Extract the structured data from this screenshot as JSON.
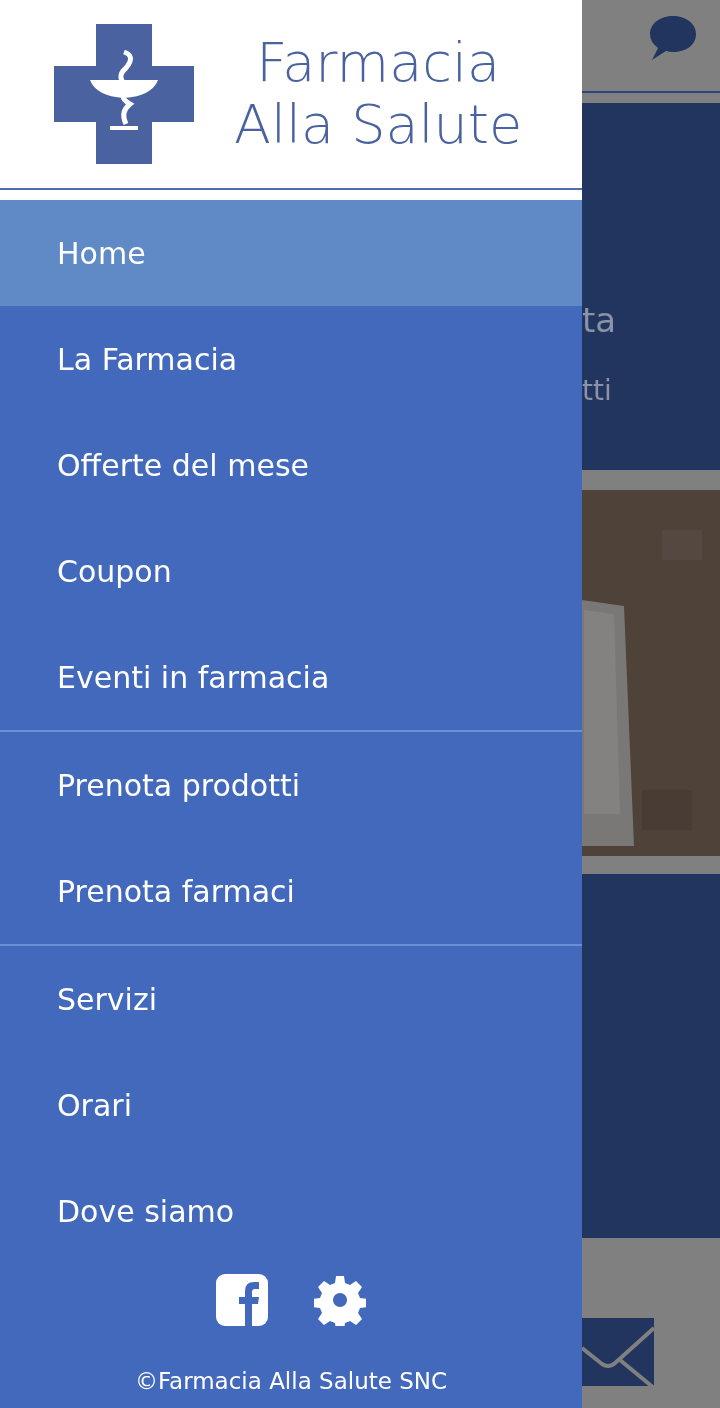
{
  "drawer": {
    "logo": {
      "line_1": "Farmacia",
      "line_2": "Alla Salute"
    },
    "sections": [
      {
        "items": [
          {
            "label": "Home",
            "selected": true
          },
          {
            "label": "La Farmacia",
            "selected": false
          },
          {
            "label": "Offerte del mese",
            "selected": false
          },
          {
            "label": "Coupon",
            "selected": false
          },
          {
            "label": "Eventi in farmacia",
            "selected": false
          }
        ]
      },
      {
        "items": [
          {
            "label": "Prenota prodotti",
            "selected": false
          },
          {
            "label": "Prenota farmaci",
            "selected": false
          }
        ]
      },
      {
        "items": [
          {
            "label": "Servizi",
            "selected": false
          },
          {
            "label": "Orari",
            "selected": false
          },
          {
            "label": "Dove siamo",
            "selected": false
          }
        ]
      }
    ],
    "copyright": "©Farmacia Alla Salute SNC"
  },
  "background": {
    "texts": [
      "ta",
      "tti"
    ],
    "photo": {
      "kind": "picture"
    }
  }
}
